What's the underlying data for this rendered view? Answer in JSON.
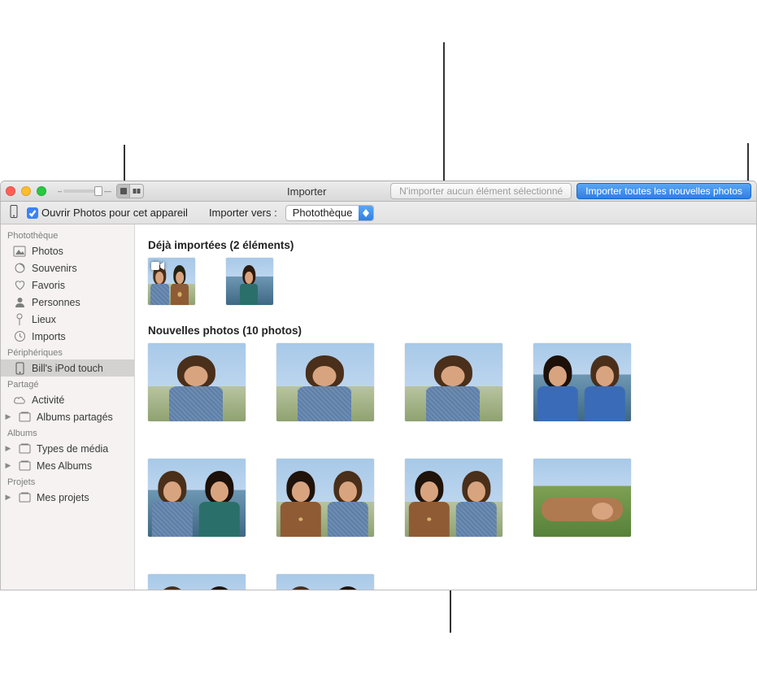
{
  "window": {
    "title": "Importer",
    "toolbar": {
      "import_selected_label": "N'importer aucun élément sélectionné",
      "import_all_label": "Importer toutes les nouvelles photos"
    },
    "options": {
      "open_photos_label": "Ouvrir Photos pour cet appareil",
      "open_photos_checked": true,
      "import_to_label": "Importer vers :",
      "import_to_value": "Photothèque"
    },
    "slider_position_pct": 80
  },
  "sidebar": {
    "groups": [
      {
        "title": "Photothèque",
        "items": [
          {
            "label": "Photos",
            "icon": "photos",
            "disclosure": false
          },
          {
            "label": "Souvenirs",
            "icon": "memories",
            "disclosure": false
          },
          {
            "label": "Favoris",
            "icon": "heart",
            "disclosure": false
          },
          {
            "label": "Personnes",
            "icon": "person",
            "disclosure": false
          },
          {
            "label": "Lieux",
            "icon": "pin",
            "disclosure": false
          },
          {
            "label": "Imports",
            "icon": "clock",
            "disclosure": false
          }
        ]
      },
      {
        "title": "Périphériques",
        "items": [
          {
            "label": "Bill's iPod touch",
            "icon": "device",
            "disclosure": false,
            "selected": true
          }
        ]
      },
      {
        "title": "Partagé",
        "items": [
          {
            "label": "Activité",
            "icon": "cloud",
            "disclosure": false
          },
          {
            "label": "Albums partagés",
            "icon": "album",
            "disclosure": true
          }
        ]
      },
      {
        "title": "Albums",
        "items": [
          {
            "label": "Types de média",
            "icon": "album",
            "disclosure": true
          },
          {
            "label": "Mes Albums",
            "icon": "album",
            "disclosure": true
          }
        ]
      },
      {
        "title": "Projets",
        "items": [
          {
            "label": "Mes projets",
            "icon": "album",
            "disclosure": true
          }
        ]
      }
    ]
  },
  "content": {
    "already_heading": "Déjà importées (2 éléments)",
    "new_heading": "Nouvelles photos (10 photos)",
    "already_count": 2,
    "new_count": 10
  }
}
